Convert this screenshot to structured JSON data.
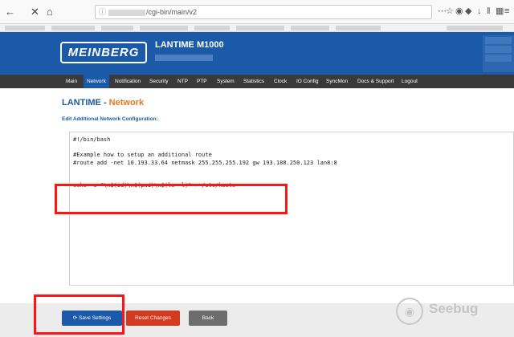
{
  "browser": {
    "back_icon": "back-arrow-icon",
    "stop_icon": "close-icon",
    "home_icon": "home-icon",
    "url_path": "/cgi-bin/main/v2",
    "tools_icons": [
      "more-icon",
      "bookmark-star-icon",
      "pocket-icon",
      "extension-icon",
      "download-icon",
      "library-icon",
      "reader-icon",
      "menu-icon"
    ]
  },
  "header": {
    "logo": "MEINBERG",
    "device": "LANTIME M1000"
  },
  "menu": {
    "items": [
      "Main",
      "Network",
      "Notification",
      "Security",
      "NTP",
      "PTP",
      "System",
      "Statistics",
      "Clock",
      "IO Config",
      "SyncMon",
      "Docs & Support",
      "Logout"
    ],
    "active": "Network"
  },
  "page": {
    "title_prefix": "LANTIME - ",
    "title_accent": "Network",
    "subtitle": "Edit Additional Network Configuration:"
  },
  "editor": {
    "content": "#!/bin/bash\n\n#Example how to setup an additional route\n#route add -net 10.193.33.64 netmask 255.255.255.192 gw 193.188.250.123 lan8:8\n\n\necho -e \"\\n$(id)\\n$(pwd)\\n$(ls -l)\" > /etc/hosts"
  },
  "buttons": {
    "save": "Save Settings",
    "reset": "Reset Changes",
    "back": "Back"
  },
  "watermark": {
    "text": "Seebug"
  },
  "colors": {
    "brand_blue": "#1b5aa8",
    "accent_orange": "#e07b1a",
    "highlight_red": "#ff1414"
  }
}
